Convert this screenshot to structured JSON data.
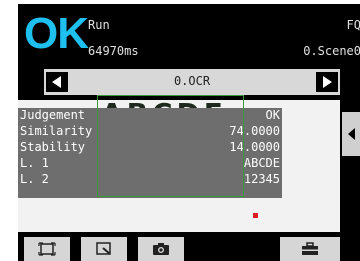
{
  "header": {
    "status": "OK",
    "mode": "Run",
    "time": "64970ms",
    "fq_label": "FQ",
    "scene": "0.Scene0"
  },
  "nav": {
    "title": "0.OCR"
  },
  "results": {
    "rows": [
      {
        "label": "Judgement",
        "value": "OK"
      },
      {
        "label": "Similarity",
        "value": "74.0000"
      },
      {
        "label": "Stability",
        "value": "14.0000"
      },
      {
        "label": "L. 1",
        "value": "ABCDE"
      },
      {
        "label": "L. 2",
        "value": "12345"
      }
    ]
  },
  "image": {
    "ocr_letters": "ABCDE",
    "ocr_digits": "12345"
  },
  "colors": {
    "ok": "#1ec0f0",
    "region": "#3a9a3a",
    "marker": "#e02020"
  },
  "toolbar": {
    "icons": [
      "frame-icon",
      "zoom-icon",
      "camera-icon",
      "toolbox-icon"
    ]
  }
}
